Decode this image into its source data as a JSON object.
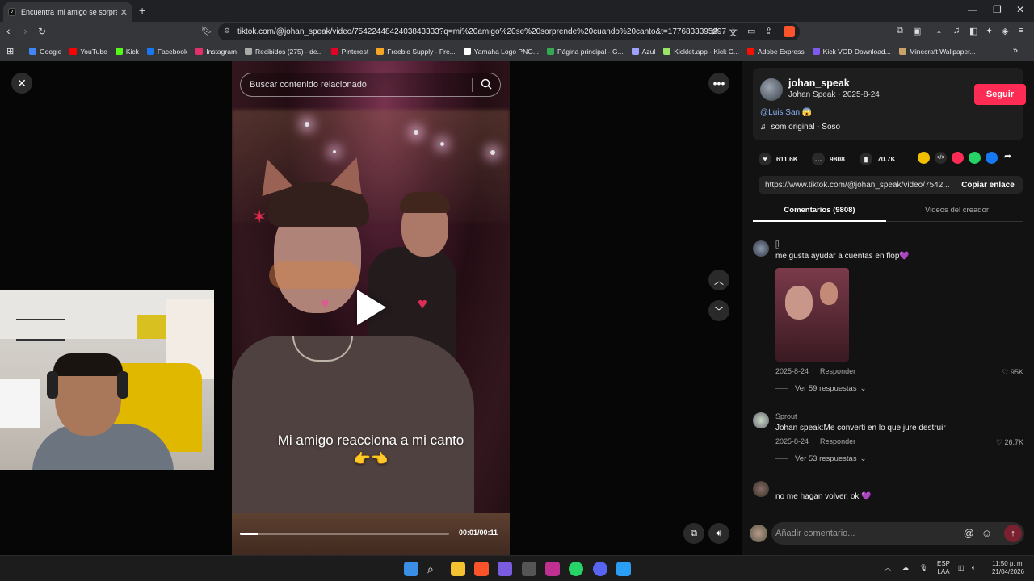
{
  "browser": {
    "tab_title": "Encuentra 'mi amigo se sorprende'",
    "url": "tiktok.com/@johan_speak/video/7542244842403843333?q=mi%20amigo%20se%20sorprende%20cuando%20canto&t=1776833395297",
    "bookmarks": [
      "Google",
      "YouTube",
      "Kick",
      "Facebook",
      "Instagram",
      "Recibidos (275) - de...",
      "Pinterest",
      "Freebie Supply - Fre...",
      "Yamaha Logo PNG...",
      "Página principal - G...",
      "Azul",
      "Kicklet.app - Kick C...",
      "Adobe Express",
      "Kick VOD Download...",
      "Minecraft Wallpaper..."
    ],
    "bookmark_colors": [
      "#4285f4",
      "#ff0000",
      "#53fc18",
      "#1877f2",
      "#e1306c",
      "#aaaaaa",
      "#e60023",
      "#f5a623",
      "#ffffff",
      "#34a853",
      "#a0a0ff",
      "#9be564",
      "#fa0f00",
      "#7f5af0",
      "#c9a36a"
    ]
  },
  "video": {
    "search_placeholder": "Buscar contenido relacionado",
    "caption": "Mi amigo reacciona a mi canto 👉👈",
    "time": "00:01/00:11",
    "progress": 0.09
  },
  "panel": {
    "username": "johan_speak",
    "display_and_date": "Johan Speak · 2025-8-24",
    "follow_label": "Seguir",
    "mention": "@Luis San 😱",
    "sound": "som original - Soso",
    "likes": "611.6K",
    "comments": "9808",
    "saves": "70.7K",
    "link": "https://www.tiktok.com/@johan_speak/video/7542...",
    "copy_label": "Copiar enlace",
    "tab_comments": "Comentarios (9808)",
    "tab_creator": "Videos del creador",
    "comments_list": [
      {
        "user": "ᥫ",
        "text": "me gusta ayudar a cuentas en flop💜",
        "date": "2025-8-24",
        "reply": "Responder",
        "likes": "95K",
        "more": "Ver 59 respuestas"
      },
      {
        "user": "Sprout",
        "text": "Johan speak:Me converti en lo que jure destruir",
        "date": "2025-8-24",
        "reply": "Responder",
        "likes": "26.7K",
        "more": "Ver 53 respuestas"
      },
      {
        "user": ".",
        "text": "no me hagan volver, ok 💜"
      }
    ],
    "comment_placeholder": "Añadir comentario..."
  },
  "taskbar": {
    "lang_top": "ESP",
    "lang_bottom": "LAA",
    "time": "11:50 p. m.",
    "date": "21/04/2026"
  },
  "icons": [
    "close-icon",
    "search-icon",
    "more-icon",
    "chevron-up-icon",
    "chevron-down-icon",
    "volume-icon",
    "play-icon",
    "heart-icon",
    "comment-icon",
    "bookmark-icon",
    "share-icon",
    "emoji-icon",
    "at-icon",
    "send-icon"
  ]
}
